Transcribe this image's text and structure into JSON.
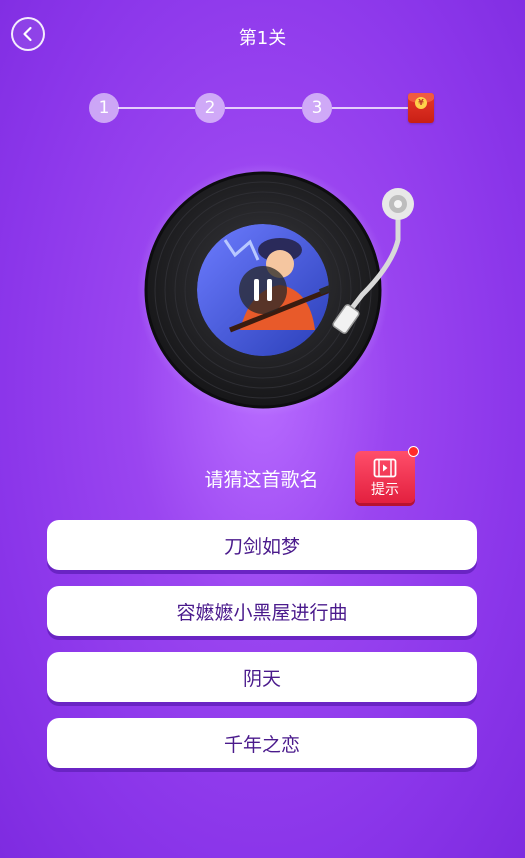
{
  "header": {
    "title": "第1关",
    "back_icon": "chevron-left-icon"
  },
  "progress": {
    "steps": [
      "1",
      "2",
      "3"
    ],
    "reward_icon": "red-envelope-icon",
    "reward_coin": "¥"
  },
  "player": {
    "state_icon": "pause-icon"
  },
  "question": {
    "prompt": "请猜这首歌名",
    "hint_label": "提示",
    "hint_icon": "video-icon"
  },
  "options": [
    "刀剑如梦",
    "容嬷嬷小黑屋进行曲",
    "阴天",
    "千年之恋"
  ],
  "colors": {
    "background": "#9a45f0",
    "option_text": "#4a1a8c",
    "hint_button": "#e3203f"
  }
}
